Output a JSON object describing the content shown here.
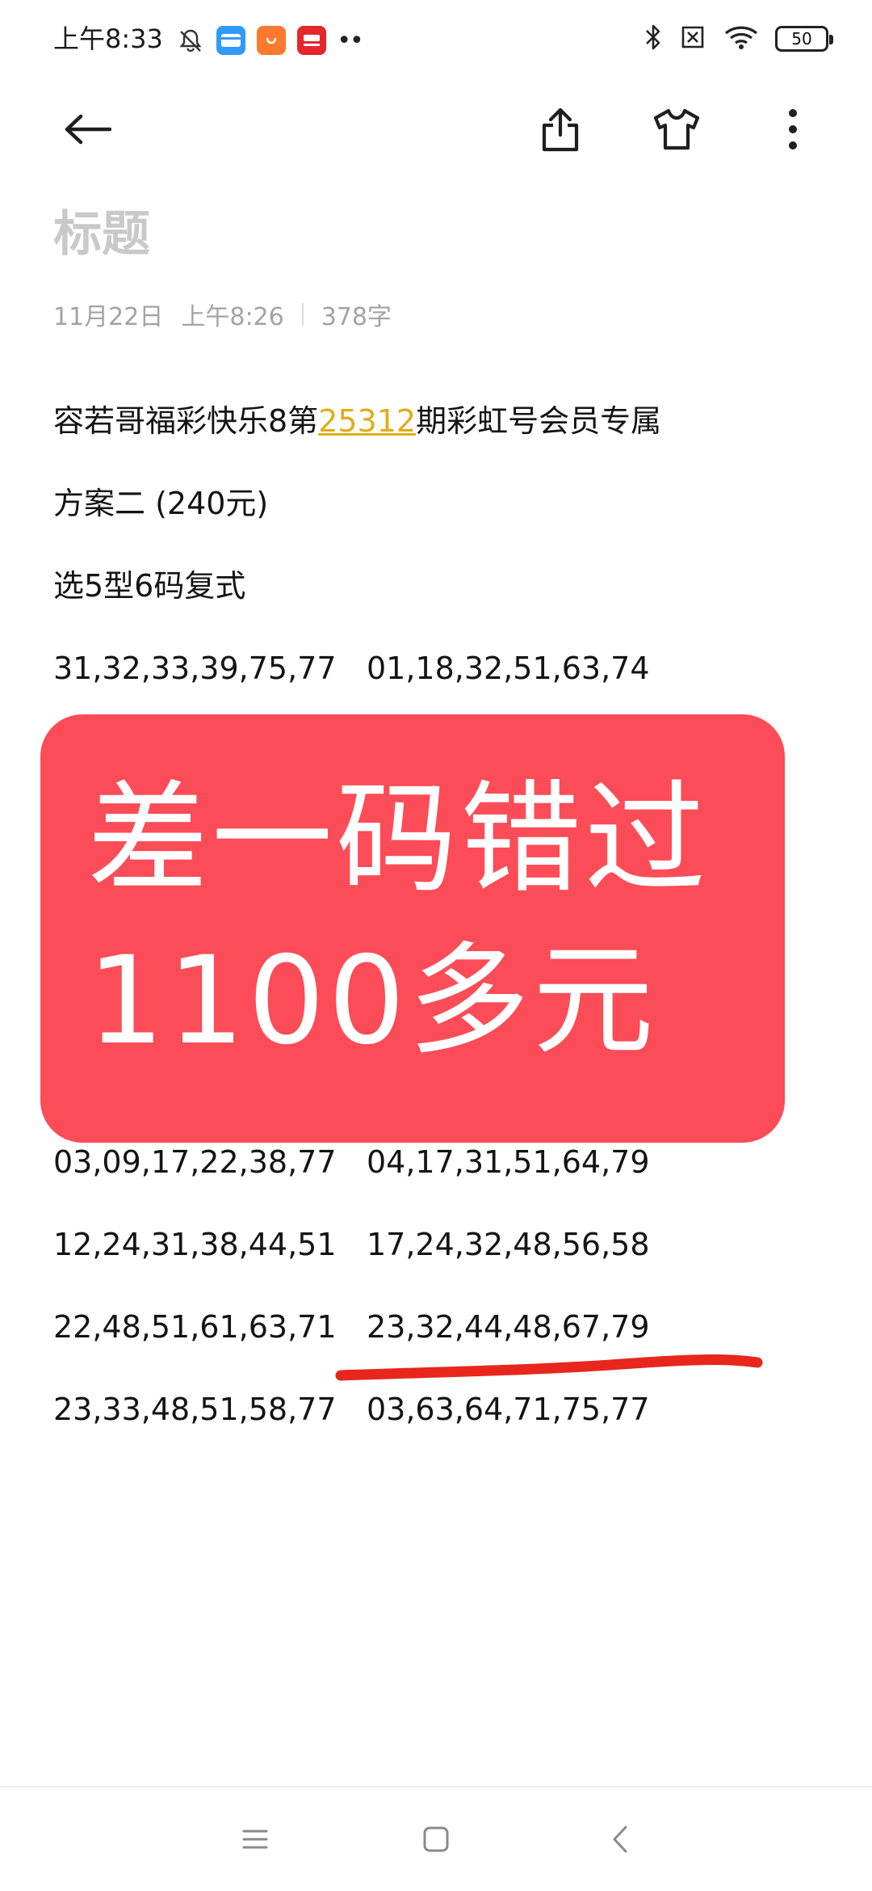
{
  "status_bar": {
    "time": "上午8:33",
    "notif_icons": [
      "bell-off-icon",
      "wallet-app-icon",
      "shop-app-icon",
      "red-app-icon"
    ],
    "more_notifications": "••",
    "battery_level": "50",
    "sys_icons": [
      "bluetooth-icon",
      "no-sim-icon",
      "wifi-icon",
      "battery-icon"
    ]
  },
  "toolbar": {
    "icons": [
      "back-arrow-icon",
      "share-icon",
      "theme-shirt-icon",
      "more-vertical-icon"
    ]
  },
  "note": {
    "title_placeholder": "标题",
    "date": "11月22日",
    "time": "上午8:26",
    "char_count": "378字",
    "line1_prefix": "容若哥福彩快乐8第",
    "issue_number": "25312",
    "line1_suffix": "期彩虹号会员专属",
    "line2": "方案二 (240元)",
    "line3": "选5型6码复式",
    "rows": [
      {
        "left": "31,32,33,39,75,77",
        "right": "01,18,32,51,63,74"
      },
      {
        "left": "03,09,17,22,38,77",
        "right": "04,17,31,51,64,79"
      },
      {
        "left": "12,24,31,38,44,51",
        "right": "17,24,32,48,56,58"
      },
      {
        "left": "22,48,51,61,63,71",
        "right": "23,32,44,48,67,79"
      },
      {
        "left": "23,33,48,51,58,77",
        "right": "03,63,64,71,75,77"
      }
    ]
  },
  "banner": {
    "line1": "差一码错过",
    "line2": "1100多元",
    "color": "#fc4c58"
  },
  "highlight": {
    "color": "#e8261c"
  },
  "nav": {
    "icons": [
      "menu-icon",
      "home-icon",
      "back-icon"
    ]
  },
  "colors": {
    "issue_link": "#e0ac19",
    "title_placeholder": "#c9c9c9",
    "meta": "#a3a3a3"
  }
}
